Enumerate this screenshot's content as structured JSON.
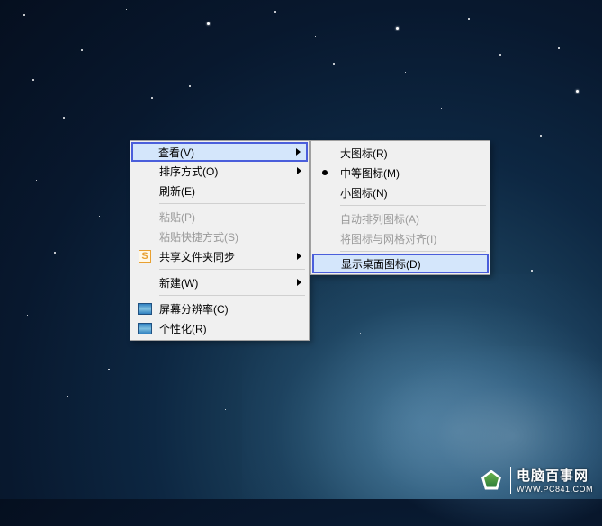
{
  "context_menu": {
    "view": "查看(V)",
    "sort": "排序方式(O)",
    "refresh": "刷新(E)",
    "paste": "粘贴(P)",
    "paste_shortcut": "粘贴快捷方式(S)",
    "share_sync": "共享文件夹同步",
    "new": "新建(W)",
    "screen_res": "屏幕分辨率(C)",
    "personalize": "个性化(R)"
  },
  "submenu": {
    "large_icons": "大图标(R)",
    "medium_icons": "中等图标(M)",
    "small_icons": "小图标(N)",
    "auto_arrange": "自动排列图标(A)",
    "align_grid": "将图标与网格对齐(I)",
    "show_desktop_icons": "显示桌面图标(D)"
  },
  "watermark": {
    "name": "电脑百事网",
    "url": "WWW.PC841.COM"
  }
}
